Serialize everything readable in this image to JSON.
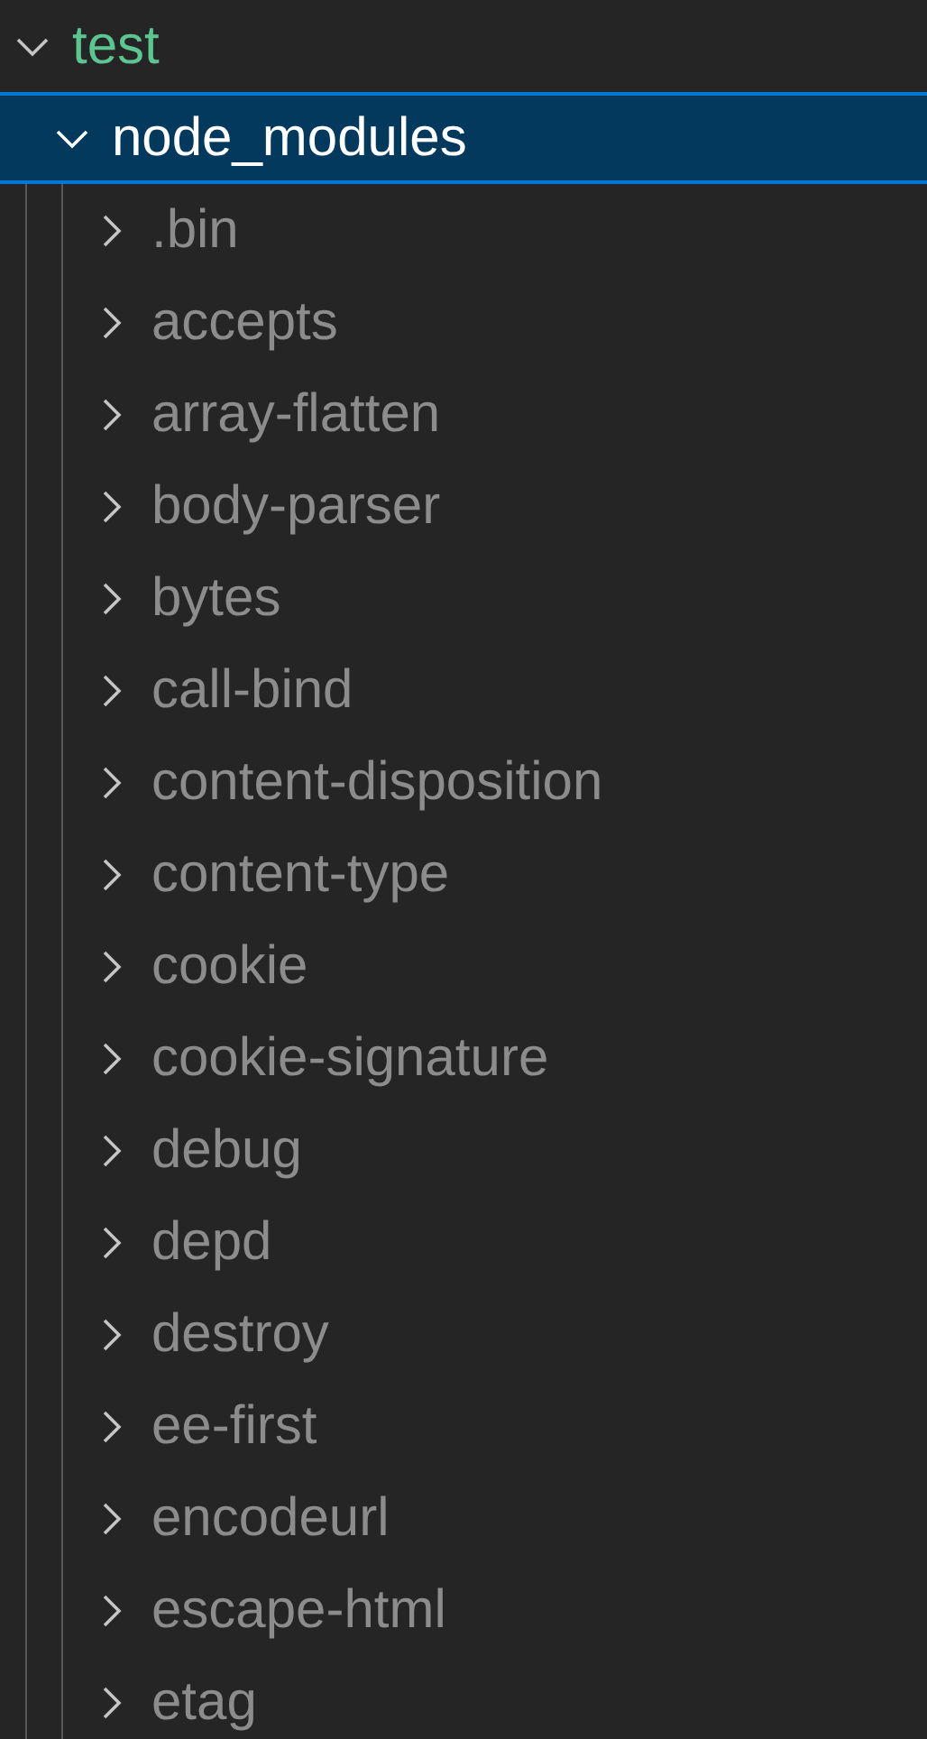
{
  "explorer": {
    "tree": [
      {
        "name": "test",
        "expanded": true,
        "selected": false,
        "color": "#5cc690",
        "children": [
          {
            "name": "node_modules",
            "expanded": true,
            "selected": true,
            "children": [
              {
                "name": ".bin",
                "expanded": false,
                "selected": false,
                "ignored": true
              },
              {
                "name": "accepts",
                "expanded": false,
                "selected": false,
                "ignored": true
              },
              {
                "name": "array-flatten",
                "expanded": false,
                "selected": false,
                "ignored": true
              },
              {
                "name": "body-parser",
                "expanded": false,
                "selected": false,
                "ignored": true
              },
              {
                "name": "bytes",
                "expanded": false,
                "selected": false,
                "ignored": true
              },
              {
                "name": "call-bind",
                "expanded": false,
                "selected": false,
                "ignored": true
              },
              {
                "name": "content-disposition",
                "expanded": false,
                "selected": false,
                "ignored": true
              },
              {
                "name": "content-type",
                "expanded": false,
                "selected": false,
                "ignored": true
              },
              {
                "name": "cookie",
                "expanded": false,
                "selected": false,
                "ignored": true
              },
              {
                "name": "cookie-signature",
                "expanded": false,
                "selected": false,
                "ignored": true
              },
              {
                "name": "debug",
                "expanded": false,
                "selected": false,
                "ignored": true
              },
              {
                "name": "depd",
                "expanded": false,
                "selected": false,
                "ignored": true
              },
              {
                "name": "destroy",
                "expanded": false,
                "selected": false,
                "ignored": true
              },
              {
                "name": "ee-first",
                "expanded": false,
                "selected": false,
                "ignored": true
              },
              {
                "name": "encodeurl",
                "expanded": false,
                "selected": false,
                "ignored": true
              },
              {
                "name": "escape-html",
                "expanded": false,
                "selected": false,
                "ignored": true
              },
              {
                "name": "etag",
                "expanded": false,
                "selected": false,
                "ignored": true
              }
            ]
          }
        ]
      }
    ]
  }
}
